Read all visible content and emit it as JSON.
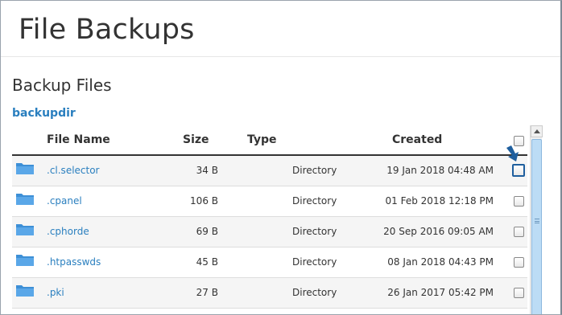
{
  "page": {
    "title": "File Backups"
  },
  "section": {
    "title": "Backup Files",
    "directory_link": "backupdir"
  },
  "table": {
    "columns": {
      "name": "File Name",
      "size": "Size",
      "type": "Type",
      "created": "Created"
    },
    "rows": [
      {
        "name": ".cl.selector",
        "size": "34 B",
        "type": "Directory",
        "created": "19 Jan 2018 04:48 AM",
        "icon": "folder-icon",
        "highlighted": true
      },
      {
        "name": ".cpanel",
        "size": "106 B",
        "type": "Directory",
        "created": "01 Feb 2018 12:18 PM",
        "icon": "folder-icon",
        "highlighted": false
      },
      {
        "name": ".cphorde",
        "size": "69 B",
        "type": "Directory",
        "created": "20 Sep 2016 09:05 AM",
        "icon": "folder-icon",
        "highlighted": false
      },
      {
        "name": ".htpasswds",
        "size": "45 B",
        "type": "Directory",
        "created": "08 Jan 2018 04:43 PM",
        "icon": "folder-icon",
        "highlighted": false
      },
      {
        "name": ".pki",
        "size": "27 B",
        "type": "Directory",
        "created": "26 Jan 2017 05:42 PM",
        "icon": "folder-icon",
        "highlighted": false
      }
    ]
  },
  "colors": {
    "link": "#2a7fbf",
    "folder": "#3d8fd6",
    "highlight": "#1f5f9e",
    "scroll_thumb": "#bcdcf5"
  },
  "annotation": {
    "icon": "arrow-down-right-icon"
  }
}
